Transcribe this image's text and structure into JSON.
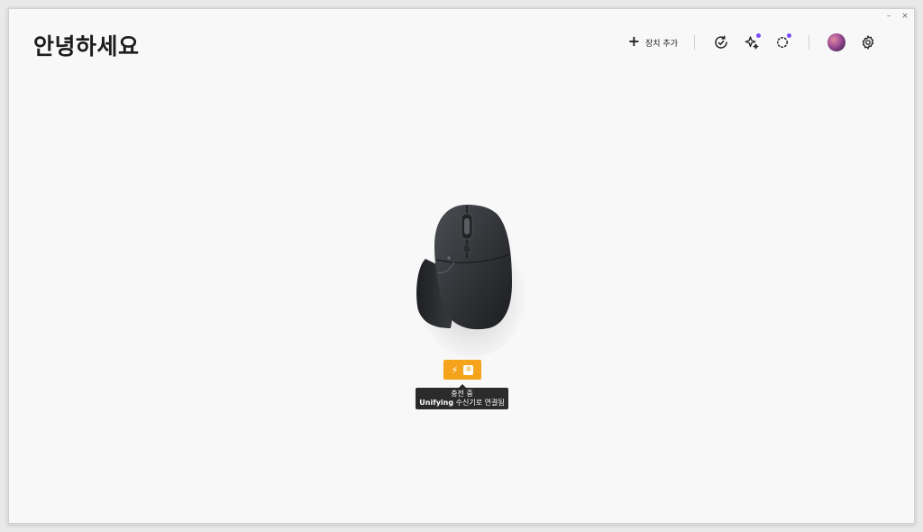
{
  "window": {
    "minimize_glyph": "–",
    "close_glyph": "×"
  },
  "greeting": "안녕하세요",
  "toolbar": {
    "add_device_label": "장치 추가",
    "icons": [
      "add-icon",
      "check-circle-icon",
      "sparkle-icon",
      "loading-icon",
      "avatar",
      "gear-icon"
    ],
    "notification_dot_color": "#7b4cff"
  },
  "device": {
    "icon": "mouse-image",
    "status": {
      "charging_icon": "bolt-icon",
      "receiver_icon": "unifying-receiver-icon",
      "color": "#f5a31a"
    },
    "tooltip": {
      "line1": "충전 중",
      "line2_bold": "Unifying",
      "line2_rest": " 수신기로 연결됨"
    }
  }
}
